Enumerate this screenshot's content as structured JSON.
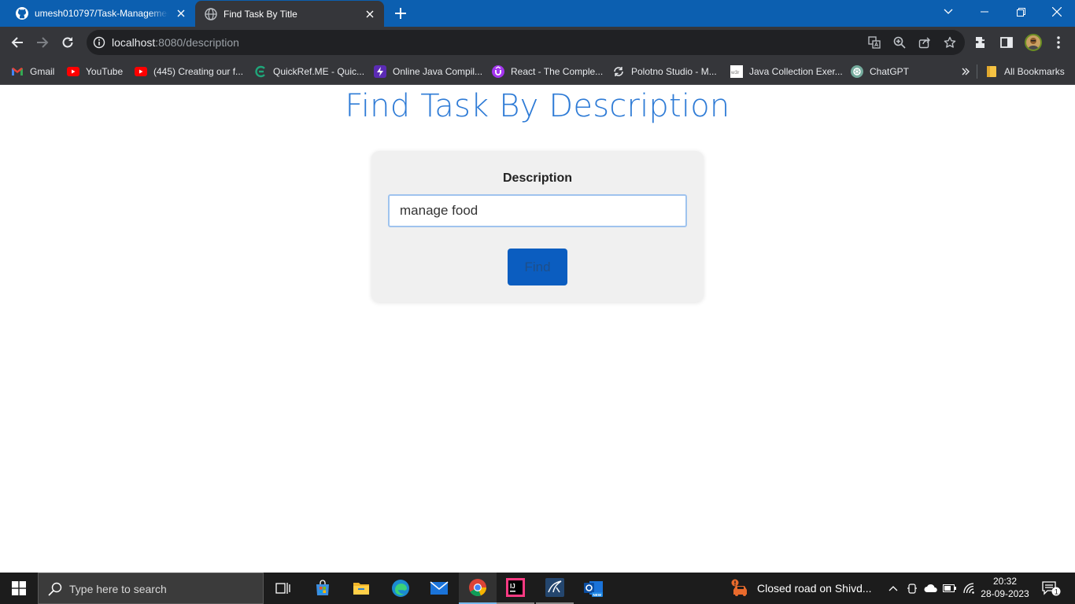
{
  "browser": {
    "tabs": [
      {
        "title": "umesh010797/Task-Management-System",
        "active": false
      },
      {
        "title": "Find Task By Title",
        "active": true
      }
    ],
    "address": {
      "host": "localhost",
      "path": ":8080/description"
    },
    "bookmarks": [
      {
        "label": "Gmail",
        "icon": "gmail-icon"
      },
      {
        "label": "YouTube",
        "icon": "youtube-icon"
      },
      {
        "label": "(445) Creating our f...",
        "icon": "youtube-icon"
      },
      {
        "label": "QuickRef.ME - Quic...",
        "icon": "quickref-icon"
      },
      {
        "label": "Online Java Compil...",
        "icon": "bolt-icon"
      },
      {
        "label": "React - The Comple...",
        "icon": "udemy-icon"
      },
      {
        "label": "Polotno Studio - M...",
        "icon": "polotno-icon"
      },
      {
        "label": "Java Collection Exer...",
        "icon": "w3r-icon"
      },
      {
        "label": "ChatGPT",
        "icon": "chatgpt-icon"
      }
    ],
    "all_bookmarks_label": "All Bookmarks",
    "w3r_text": "w3r"
  },
  "page": {
    "heading": "Find Task By Description",
    "field_label": "Description",
    "input_value": "manage food",
    "find_button": "Find"
  },
  "taskbar": {
    "search_placeholder": "Type here to search",
    "news_text": "Closed road on Shivd...",
    "time": "20:32",
    "date": "28-09-2023",
    "notification_count": "1",
    "intellij_text": "IJ",
    "outlook_badge": "NEW"
  },
  "colors": {
    "tab_strip": "#0c5fb0",
    "toolbar": "#35363a",
    "heading": "#2e7bd6",
    "button": "#0b5dc0",
    "taskbar": "#1c1c1c"
  }
}
